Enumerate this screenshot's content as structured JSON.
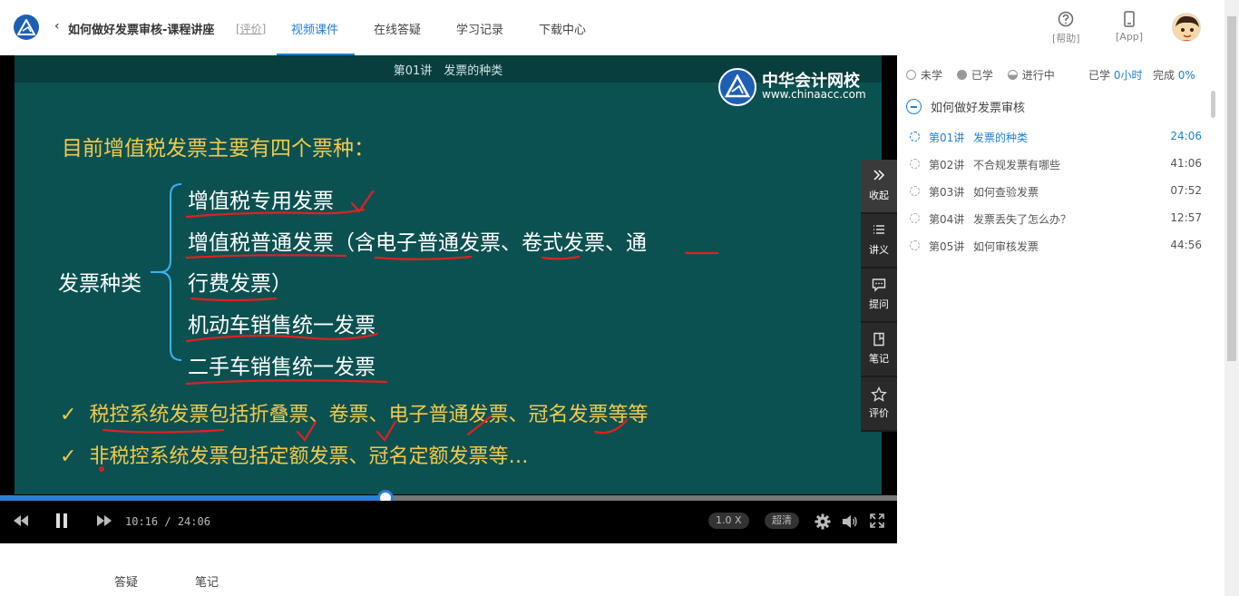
{
  "header": {
    "back_symbol": "‹",
    "course_title": "如何做好发票审核-课程讲座",
    "rate_link": "[评价]",
    "tabs": [
      {
        "label": "视频课件",
        "active": true
      },
      {
        "label": "在线答疑",
        "active": false
      },
      {
        "label": "学习记录",
        "active": false
      },
      {
        "label": "下载中心",
        "active": false
      }
    ],
    "help_label": "[帮助]",
    "app_label": "[App]",
    "avatar_icon": "user-avatar-icon"
  },
  "slide": {
    "caption": "第01讲　发票的种类",
    "brand_cn": "中华会计网校",
    "brand_en": "www.chinaacc.com",
    "heading": "目前增值税发票主要有四个票种：",
    "category_label": "发票种类",
    "items": [
      "增值税专用发票",
      "增值税普通发票（含电子普通发票、卷式发票、通",
      "行费发票）",
      "机动车销售统一发票",
      "二手车销售统一发票"
    ],
    "bullets": [
      {
        "mark": "✓",
        "text": "税控系统发票包括折叠票、卷票、电子普通发票、冠名发票等等"
      },
      {
        "mark": "✓",
        "text": "非税控系统发票包括定额发票、冠名定额发票等…"
      }
    ],
    "colors": {
      "background": "#0c5151",
      "heading": "#f2c94c",
      "text": "#ffffff",
      "annotation": "#e02020"
    }
  },
  "side_rail": [
    {
      "label": "收起",
      "icon": "double-chevron-right-icon"
    },
    {
      "label": "讲义",
      "icon": "list-icon"
    },
    {
      "label": "提问",
      "icon": "chat-icon"
    },
    {
      "label": "笔记",
      "icon": "note-icon"
    },
    {
      "label": "评价",
      "icon": "star-icon"
    }
  ],
  "player": {
    "current_time": "10:16",
    "separator": " / ",
    "total_time": "24:06",
    "speed": "1.0 X",
    "quality": "超清",
    "played_fraction": 0.43,
    "buffer_fraction": 0.13,
    "colors": {
      "played": "#2e7fd6"
    }
  },
  "panel": {
    "legend": [
      {
        "label": "未学",
        "state": "unlearned"
      },
      {
        "label": "已学",
        "state": "learned"
      },
      {
        "label": "进行中",
        "state": "in-progress"
      }
    ],
    "stats": {
      "learned_label": "已学",
      "learned_value": "0小时",
      "complete_label": "完成",
      "complete_value": "0%"
    },
    "chapter": "如何做好发票审核",
    "lessons": [
      {
        "no": "第01讲",
        "name": "发票的种类",
        "duration": "24:06",
        "current": true
      },
      {
        "no": "第02讲",
        "name": "不合规发票有哪些",
        "duration": "41:06",
        "current": false
      },
      {
        "no": "第03讲",
        "name": "如何查验发票",
        "duration": "07:52",
        "current": false
      },
      {
        "no": "第04讲",
        "name": "发票丢失了怎么办？",
        "duration": "12:57",
        "current": false
      },
      {
        "no": "第05讲",
        "name": "如何审核发票",
        "duration": "44:56",
        "current": false
      }
    ]
  },
  "bottom_tabs": [
    "答疑",
    "笔记"
  ]
}
